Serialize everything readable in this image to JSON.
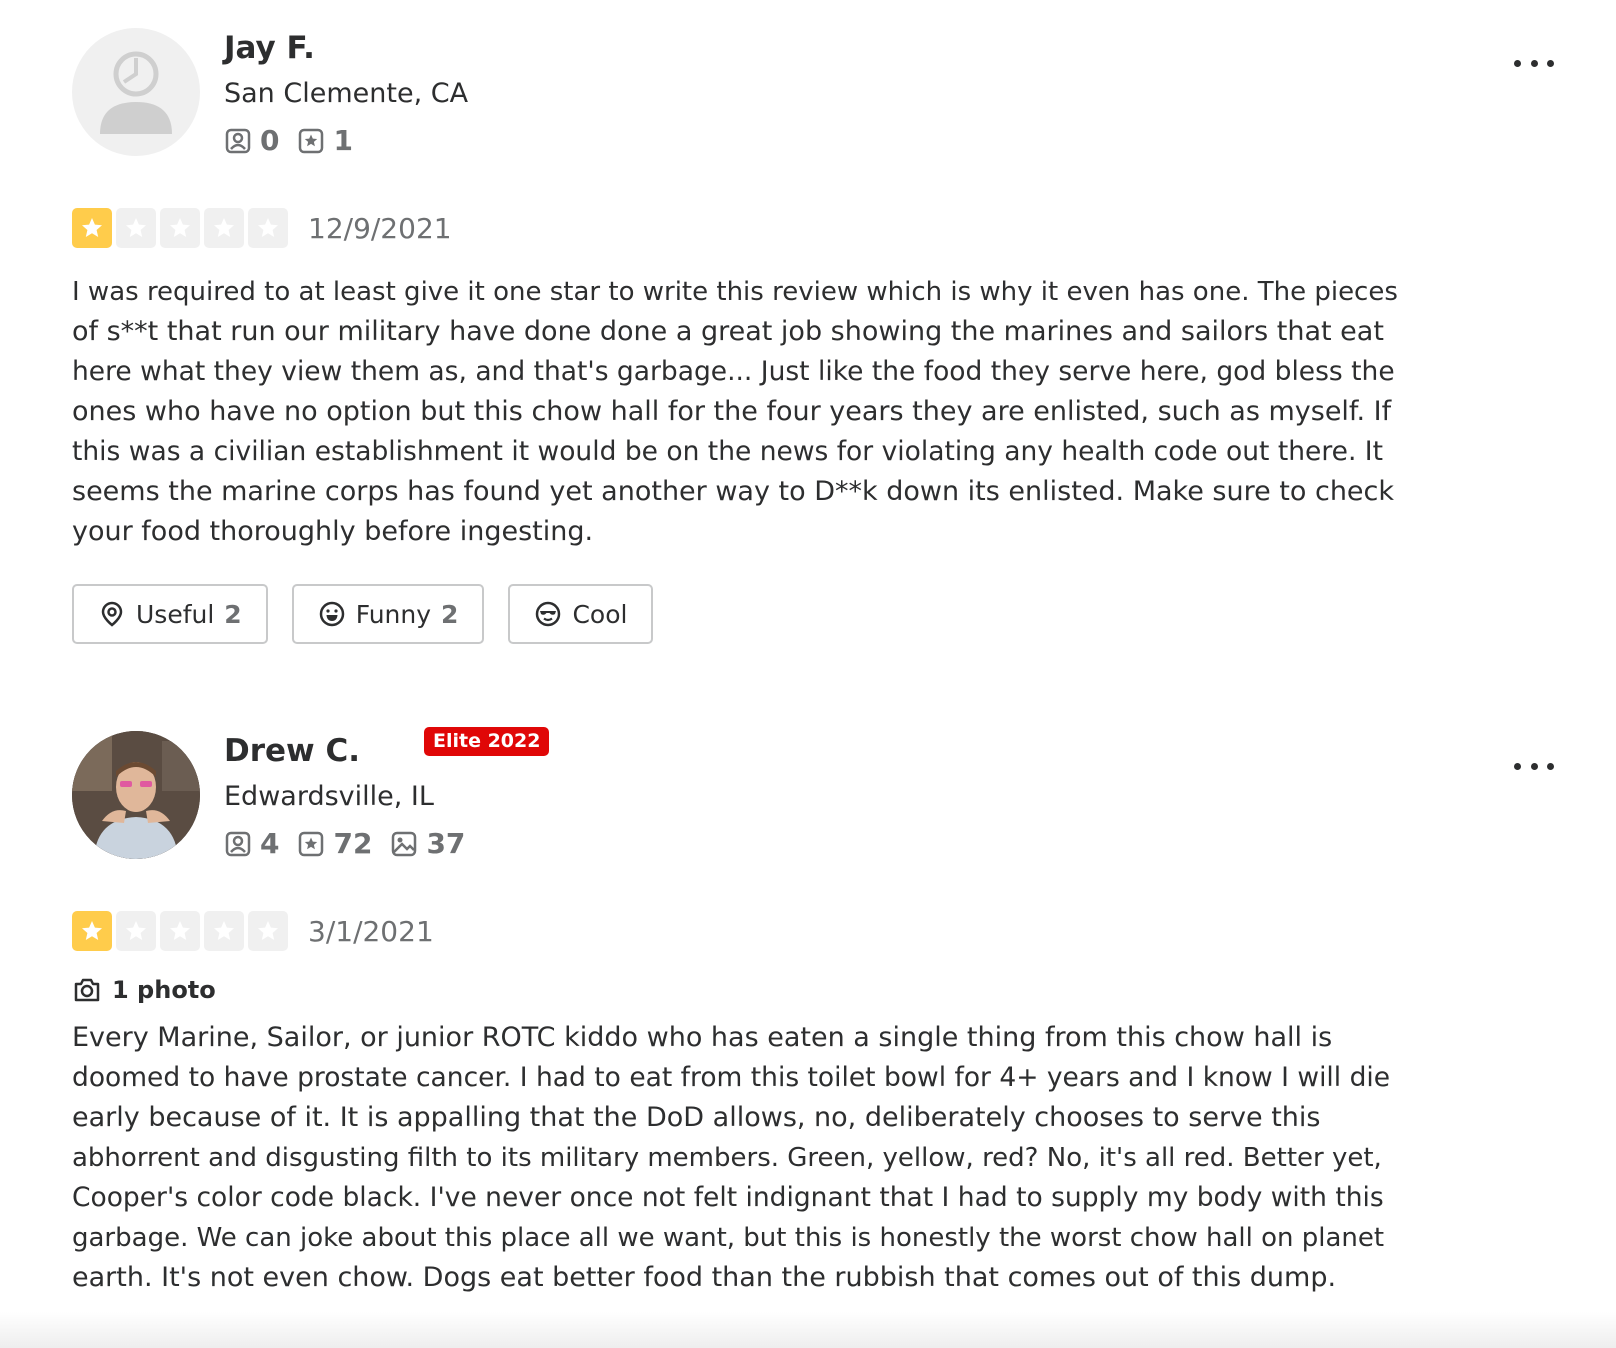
{
  "reviews": [
    {
      "user": {
        "name": "Jay F.",
        "location": "San Clemente, CA",
        "friends": "0",
        "reviews": "1",
        "elite": null
      },
      "rating": 1,
      "date": "12/9/2021",
      "text_lines": [
        "I was required to at least give it one star to write this review which is why it even has one. The pieces",
        "of s**t that run our military have done done a great job showing the marines and sailors that eat",
        "here what they view them as, and that's garbage... Just like the food they serve here, god bless the",
        "ones who have no option but this chow hall for the four years they are enlisted, such as myself. If",
        "this was a civilian establishment it would be on the news for violating any health code out there. It",
        "seems the marine corps has found yet another way to D**k down its enlisted. Make sure to check",
        "your food thoroughly before ingesting."
      ],
      "actions": {
        "useful_label": "Useful",
        "useful_count": "2",
        "funny_label": "Funny",
        "funny_count": "2",
        "cool_label": "Cool"
      }
    },
    {
      "user": {
        "name": "Drew C.",
        "location": "Edwardsville, IL",
        "friends": "4",
        "reviews": "72",
        "photos": "37",
        "elite": "Elite 2022"
      },
      "rating": 1,
      "date": "3/1/2021",
      "photo_count_label": "1 photo",
      "text_lines": [
        "Every Marine, Sailor, or junior ROTC kiddo who has eaten a single thing from this chow hall is",
        "doomed to have prostate cancer. I had to eat from this toilet bowl for 4+ years and I know I will die",
        "early because of it. It is appalling that the DoD allows, no, deliberately chooses to serve this",
        "abhorrent and disgusting filth to its military members. Green, yellow, red? No, it's all red. Better yet,",
        "Cooper's color code black. I've never once not felt indignant that I had to supply my body with this",
        "garbage. We can joke about this place all we want, but this is honestly the worst chow hall on planet",
        "earth. It's not even chow. Dogs eat better food than the rubbish that comes out of this dump."
      ]
    }
  ],
  "colors": {
    "star_filled": "#ffcc4b",
    "star_empty": "#f0f0f0",
    "elite_badge": "#e00707",
    "text": "#2d2e2f",
    "muted": "#6e7072"
  },
  "icons": [
    "friends-icon",
    "reviews-icon",
    "photos-icon",
    "star-icon",
    "useful-icon",
    "funny-icon",
    "cool-icon",
    "camera-icon",
    "more-options-icon"
  ]
}
